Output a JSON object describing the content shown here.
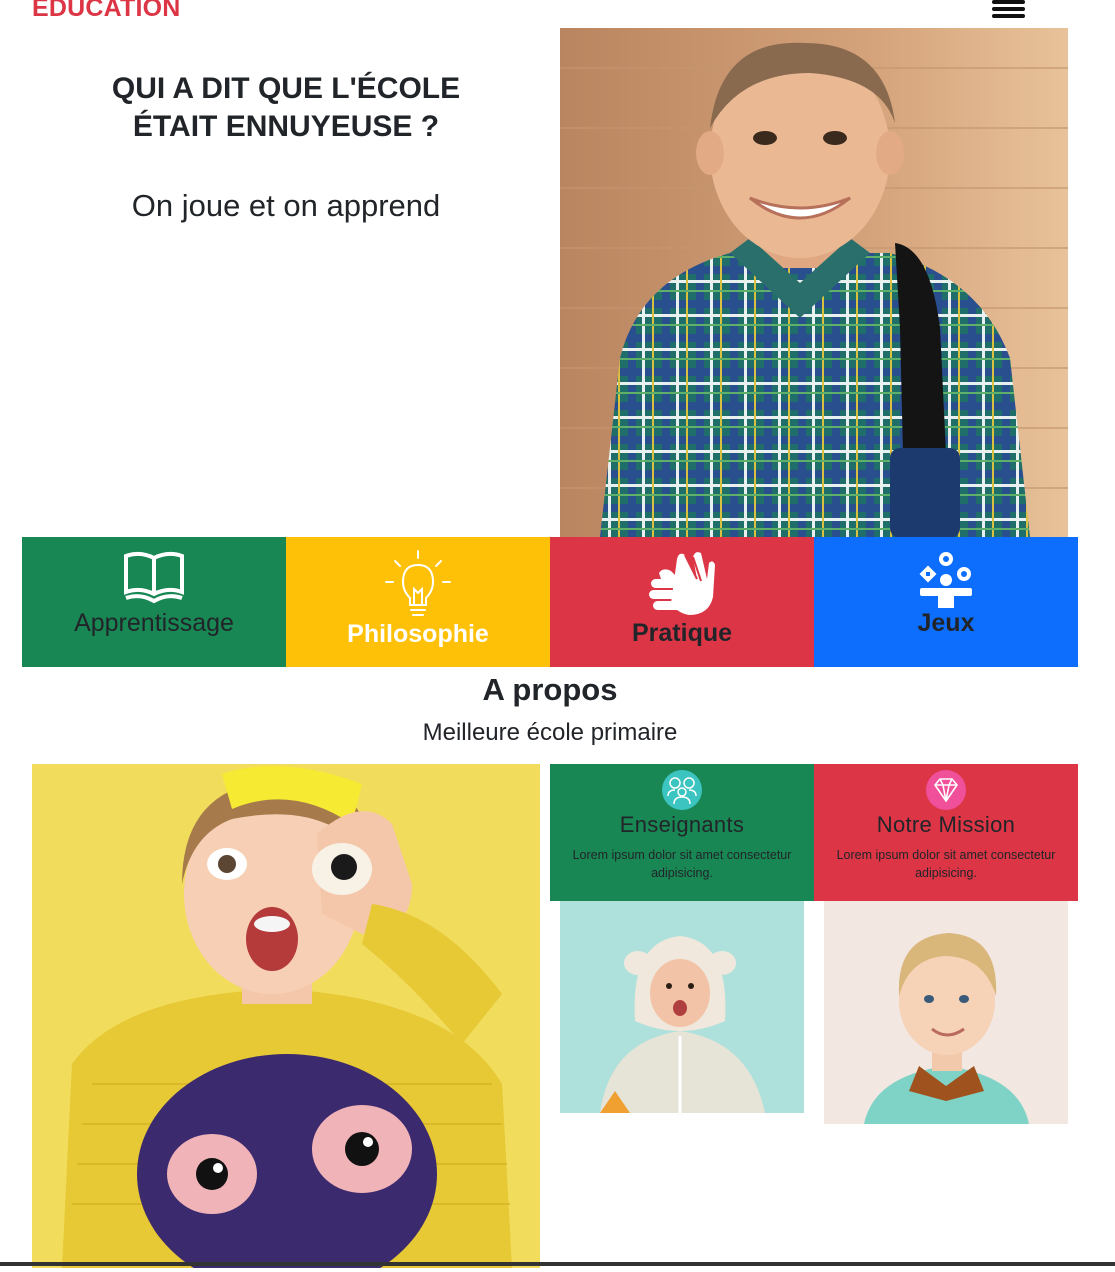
{
  "navbar": {
    "brand": "EDUCATION",
    "brand_color": "#dc3545",
    "menu_icon": "hamburger-menu-icon"
  },
  "hero": {
    "title_line1": "QUI A DIT QUE L'ÉCOLE",
    "title_line2": "ÉTAIT ENNUYEUSE ?",
    "subtitle": "On joue et on apprend",
    "image": "smiling-schoolboy-with-backpack-photo"
  },
  "tiles": [
    {
      "label": "Apprentissage",
      "icon": "open-book-icon",
      "bg": "#198754",
      "text_color": "#212529"
    },
    {
      "label": "Philosophie",
      "icon": "lightbulb-icon",
      "bg": "#ffc107",
      "text_color": "#ffffff"
    },
    {
      "label": "Pratique",
      "icon": "clapping-hands-icon",
      "bg": "#dc3545",
      "text_color": "#212529"
    },
    {
      "label": "Jeux",
      "icon": "toys-icon",
      "bg": "#0d6efd",
      "text_color": "#212529"
    }
  ],
  "about": {
    "title": "A propos",
    "subtitle": "Meilleure école primaire",
    "main_image": "girl-yellow-sweater-photo",
    "cards": [
      {
        "title": "Enseignants",
        "text": "Lorem ipsum dolor sit amet consectetur adipisicing.",
        "icon": "teachers-group-icon",
        "bg": "#198754"
      },
      {
        "title": "Notre Mission",
        "text": "Lorem ipsum dolor sit amet consectetur adipisicing.",
        "icon": "diamond-icon",
        "bg": "#dc3545"
      }
    ],
    "thumb_images": [
      "child-in-raincoat-photo",
      "blond-boy-smiling-photo"
    ]
  }
}
